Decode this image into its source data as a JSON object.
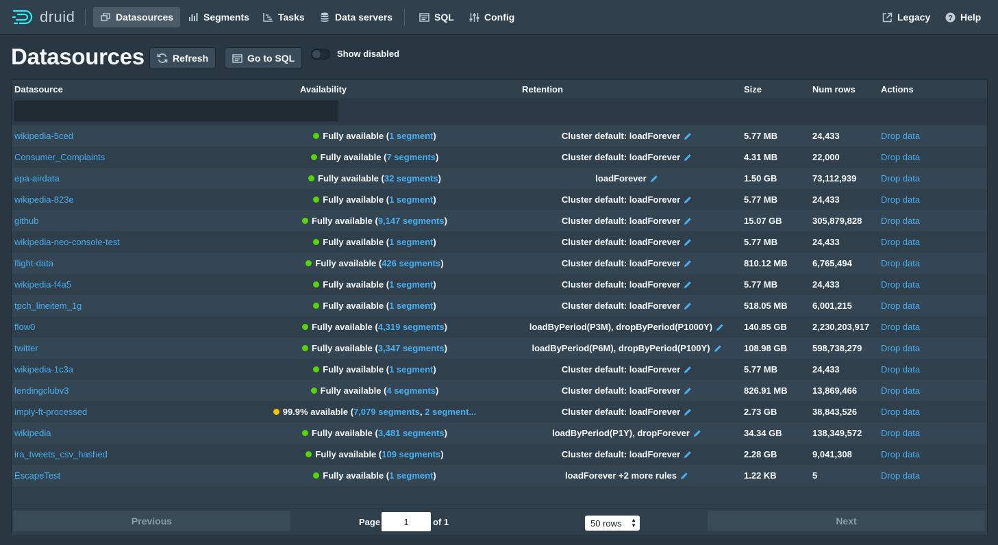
{
  "app": {
    "logo_text": "druid"
  },
  "nav": {
    "datasources": "Datasources",
    "segments": "Segments",
    "tasks": "Tasks",
    "data_servers": "Data servers",
    "sql": "SQL",
    "config": "Config",
    "legacy": "Legacy",
    "help": "Help"
  },
  "header": {
    "title": "Datasources",
    "refresh": "Refresh",
    "go_to_sql": "Go to SQL",
    "show_disabled": "Show disabled"
  },
  "table": {
    "columns": {
      "datasource": "Datasource",
      "availability": "Availability",
      "retention": "Retention",
      "size": "Size",
      "num_rows": "Num rows",
      "actions": "Actions"
    },
    "action_label": "Drop data",
    "status_colors": {
      "full": "#57d500",
      "partial": "#ffbf00"
    },
    "rows": [
      {
        "name": "wikipedia-5ced",
        "status": "full",
        "avail_pre": "Fully available (",
        "seg": "1 segment",
        "seg2": "",
        "avail_post": ")",
        "retention": "Cluster default: loadForever",
        "size": "5.77 MB",
        "rows": "24,433"
      },
      {
        "name": "Consumer_Complaints",
        "status": "full",
        "avail_pre": "Fully available (",
        "seg": "7 segments",
        "seg2": "",
        "avail_post": ")",
        "retention": "Cluster default: loadForever",
        "size": "4.31 MB",
        "rows": "22,000"
      },
      {
        "name": "epa-airdata",
        "status": "full",
        "avail_pre": "Fully available (",
        "seg": "32 segments",
        "seg2": "",
        "avail_post": ")",
        "retention": "loadForever",
        "size": "1.50 GB",
        "rows": "73,112,939"
      },
      {
        "name": "wikipedia-823e",
        "status": "full",
        "avail_pre": "Fully available (",
        "seg": "1 segment",
        "seg2": "",
        "avail_post": ")",
        "retention": "Cluster default: loadForever",
        "size": "5.77 MB",
        "rows": "24,433"
      },
      {
        "name": "github",
        "status": "full",
        "avail_pre": "Fully available (",
        "seg": "9,147 segments",
        "seg2": "",
        "avail_post": ")",
        "retention": "Cluster default: loadForever",
        "size": "15.07 GB",
        "rows": "305,879,828"
      },
      {
        "name": "wikipedia-neo-console-test",
        "status": "full",
        "avail_pre": "Fully available (",
        "seg": "1 segment",
        "seg2": "",
        "avail_post": ")",
        "retention": "Cluster default: loadForever",
        "size": "5.77 MB",
        "rows": "24,433"
      },
      {
        "name": "flight-data",
        "status": "full",
        "avail_pre": "Fully available (",
        "seg": "426 segments",
        "seg2": "",
        "avail_post": ")",
        "retention": "Cluster default: loadForever",
        "size": "810.12 MB",
        "rows": "6,765,494"
      },
      {
        "name": "wikipedia-f4a5",
        "status": "full",
        "avail_pre": "Fully available (",
        "seg": "1 segment",
        "seg2": "",
        "avail_post": ")",
        "retention": "Cluster default: loadForever",
        "size": "5.77 MB",
        "rows": "24,433"
      },
      {
        "name": "tpch_lineitem_1g",
        "status": "full",
        "avail_pre": "Fully available (",
        "seg": "1 segment",
        "seg2": "",
        "avail_post": ")",
        "retention": "Cluster default: loadForever",
        "size": "518.05 MB",
        "rows": "6,001,215"
      },
      {
        "name": "flow0",
        "status": "full",
        "avail_pre": "Fully available (",
        "seg": "4,319 segments",
        "seg2": "",
        "avail_post": ")",
        "retention": "loadByPeriod(P3M), dropByPeriod(P1000Y)",
        "size": "140.85 GB",
        "rows": "2,230,203,917"
      },
      {
        "name": "twitter",
        "status": "full",
        "avail_pre": "Fully available (",
        "seg": "3,347 segments",
        "seg2": "",
        "avail_post": ")",
        "retention": "loadByPeriod(P6M), dropByPeriod(P100Y)",
        "size": "108.98 GB",
        "rows": "598,738,279"
      },
      {
        "name": "wikipedia-1c3a",
        "status": "full",
        "avail_pre": "Fully available (",
        "seg": "1 segment",
        "seg2": "",
        "avail_post": ")",
        "retention": "Cluster default: loadForever",
        "size": "5.77 MB",
        "rows": "24,433"
      },
      {
        "name": "lendingclubv3",
        "status": "full",
        "avail_pre": "Fully available (",
        "seg": "4 segments",
        "seg2": "",
        "avail_post": ")",
        "retention": "Cluster default: loadForever",
        "size": "826.91 MB",
        "rows": "13,869,466"
      },
      {
        "name": "imply-ft-processed",
        "status": "partial",
        "avail_pre": "99.9% available (",
        "seg": "7,079 segments",
        "seg2": "2 segment...",
        "avail_post": "",
        "retention": "Cluster default: loadForever",
        "size": "2.73 GB",
        "rows": "38,843,526"
      },
      {
        "name": "wikipedia",
        "status": "full",
        "avail_pre": "Fully available (",
        "seg": "3,481 segments",
        "seg2": "",
        "avail_post": ")",
        "retention": "loadByPeriod(P1Y), dropForever",
        "size": "34.34 GB",
        "rows": "138,349,572"
      },
      {
        "name": "ira_tweets_csv_hashed",
        "status": "full",
        "avail_pre": "Fully available (",
        "seg": "109 segments",
        "seg2": "",
        "avail_post": ")",
        "retention": "Cluster default: loadForever",
        "size": "2.28 GB",
        "rows": "9,041,308"
      },
      {
        "name": "EscapeTest",
        "status": "full",
        "avail_pre": "Fully available (",
        "seg": "1 segment",
        "seg2": "",
        "avail_post": ")",
        "retention": "loadForever +2 more rules",
        "size": "1.22 KB",
        "rows": "5"
      }
    ]
  },
  "pagination": {
    "previous": "Previous",
    "next": "Next",
    "page_label": "Page",
    "page_value": "1",
    "of_label": "of 1",
    "rows_select": "50 rows"
  }
}
